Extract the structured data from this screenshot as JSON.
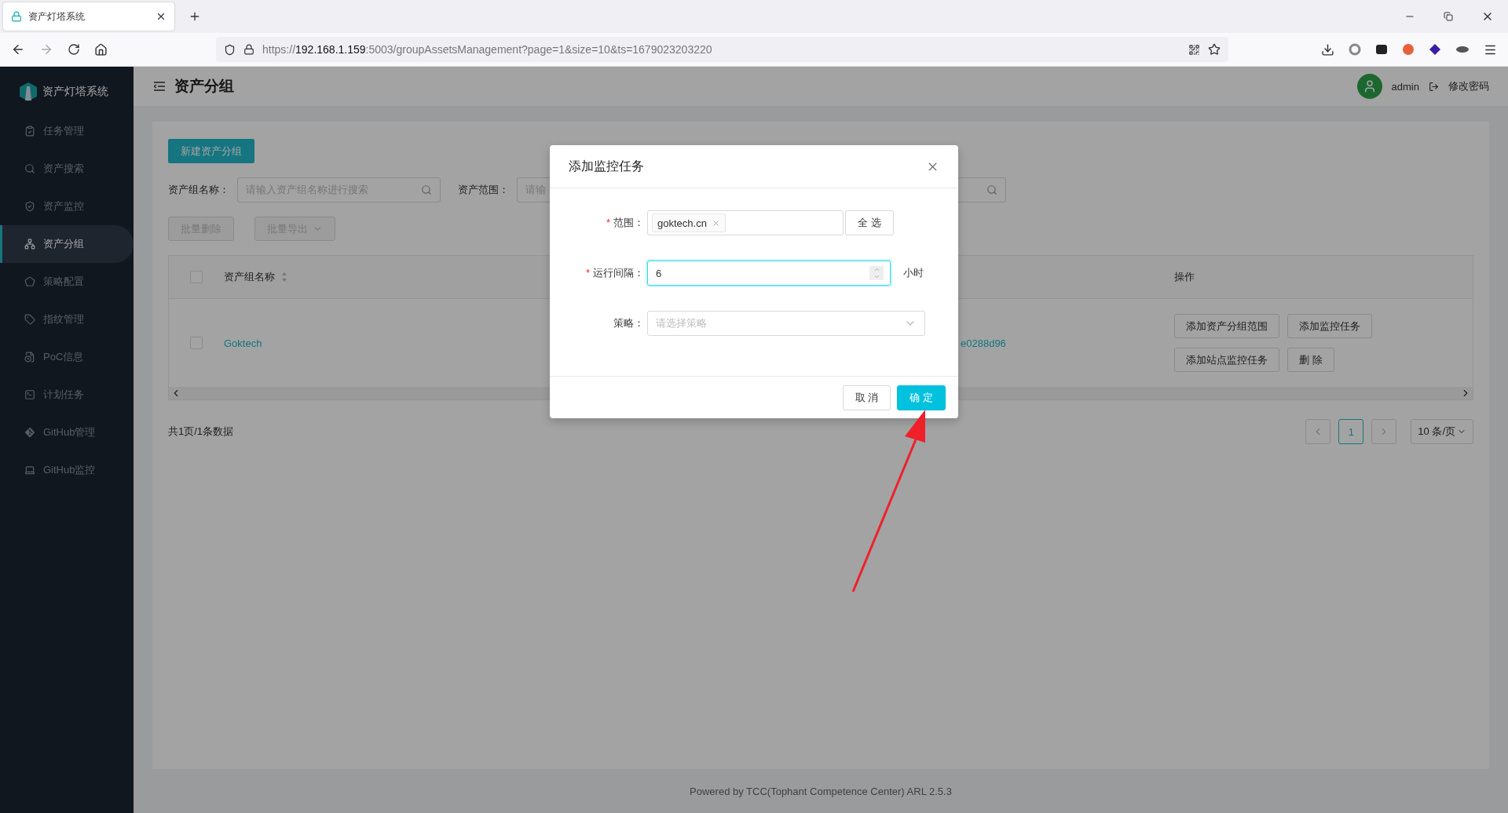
{
  "browser": {
    "tab_title": "资产灯塔系统",
    "url": {
      "scheme": "https://",
      "host": "192.168.1.159",
      "rest": ":5003/groupAssetsManagement?page=1&size=10&ts=1679023203220"
    }
  },
  "sidebar": {
    "brand": "资产灯塔系统",
    "items": [
      {
        "label": "任务管理",
        "selected": false
      },
      {
        "label": "资产搜索",
        "selected": false
      },
      {
        "label": "资产监控",
        "selected": false
      },
      {
        "label": "资产分组",
        "selected": true
      },
      {
        "label": "策略配置",
        "selected": false
      },
      {
        "label": "指纹管理",
        "selected": false
      },
      {
        "label": "PoC信息",
        "selected": false
      },
      {
        "label": "计划任务",
        "selected": false
      },
      {
        "label": "GitHub管理",
        "selected": false
      },
      {
        "label": "GitHub监控",
        "selected": false
      }
    ]
  },
  "header": {
    "title": "资产分组",
    "user": "admin",
    "change_password": "修改密码"
  },
  "toolbar": {
    "new_button": "新建资产分组",
    "filters": [
      {
        "label": "资产组名称：",
        "placeholder": "请输入资产组名称进行搜索"
      },
      {
        "label": "资产范围：",
        "placeholder": "请输"
      }
    ],
    "bulk_buttons": [
      {
        "label": "批量删除",
        "disabled": true,
        "dropdown": false
      },
      {
        "label": "批量导出",
        "disabled": true,
        "dropdown": true
      }
    ]
  },
  "table": {
    "header_checked": false,
    "columns": [
      {
        "label": "资产组名称",
        "sortable": true
      },
      {
        "label": "操作",
        "sortable": false
      }
    ],
    "rows": [
      {
        "checked": false,
        "name": "Goktech",
        "column_3": "e0288d96",
        "actions": [
          "添加资产分组范围",
          "添加监控任务",
          "添加站点监控任务",
          "删 除"
        ]
      }
    ]
  },
  "pagination": {
    "summary": "共1页/1条数据",
    "pages": [
      {
        "label": "1",
        "selected": true
      }
    ],
    "page_size": "10 条/页"
  },
  "footer": "Powered by TCC(Tophant Competence Center) ARL 2.5.3",
  "dialog": {
    "title": "添加监控任务",
    "fields": [
      {
        "kind": "tags",
        "label": "范围：",
        "required_mark": "*",
        "tags": [
          "goktech.cn"
        ],
        "button": "全 选"
      },
      {
        "kind": "number",
        "label": "运行间隔：",
        "required_mark": "*",
        "value": "6",
        "focused": true,
        "unit": "小时"
      },
      {
        "kind": "select",
        "label": "策略：",
        "placeholder": "请选择策略"
      }
    ],
    "buttons": [
      {
        "label": "取 消",
        "primary": false
      },
      {
        "label": "确 定",
        "primary": true
      }
    ]
  }
}
